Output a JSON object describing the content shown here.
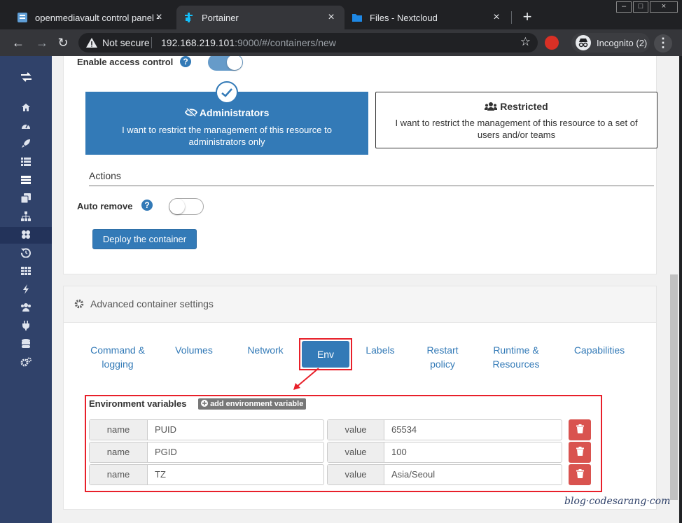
{
  "browser": {
    "tabs": [
      {
        "title": "openmediavault control panel - ",
        "active": false
      },
      {
        "title": "Portainer",
        "active": true
      },
      {
        "title": "Files - Nextcloud",
        "active": false
      }
    ],
    "not_secure": "Not secure",
    "url_host": "192.168.219.101",
    "url_rest": ":9000/#/containers/new",
    "incognito_label": "Incognito (2)"
  },
  "form": {
    "enable_access_control_label": "Enable access control",
    "enable_access_control": true,
    "admin_title": "Administrators",
    "admin_desc": "I want to restrict the management of this resource to administrators only",
    "restricted_title": "Restricted",
    "restricted_desc": "I want to restrict the management of this resource to a set of users and/or teams",
    "actions_title": "Actions",
    "auto_remove_label": "Auto remove",
    "auto_remove": false,
    "deploy_label": "Deploy the container"
  },
  "advanced": {
    "title": "Advanced container settings",
    "tabs": [
      {
        "label": "Command & logging"
      },
      {
        "label": "Volumes"
      },
      {
        "label": "Network"
      },
      {
        "label": "Env"
      },
      {
        "label": "Labels"
      },
      {
        "label": "Restart policy"
      },
      {
        "label": "Runtime & Resources"
      },
      {
        "label": "Capabilities"
      }
    ],
    "active_tab": "Env",
    "env_title": "Environment variables",
    "add_env_label": "add environment variable",
    "name_addon": "name",
    "value_addon": "value",
    "env": [
      {
        "name": "PUID",
        "value": "65534"
      },
      {
        "name": "PGID",
        "value": "100"
      },
      {
        "name": "TZ",
        "value": "Asia/Seoul"
      }
    ]
  },
  "watermark": "blog·codesarang·com",
  "colors": {
    "primary": "#337ab7",
    "sidebar": "#30426a",
    "danger": "#d9534f",
    "highlight": "#e8202a"
  }
}
